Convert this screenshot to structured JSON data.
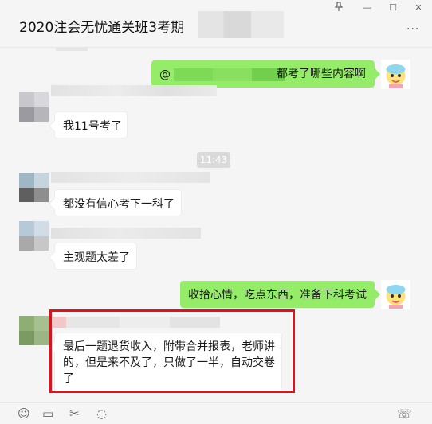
{
  "window": {
    "title": "2020注会无忧通关班3考期",
    "pin_icon": "pin-icon",
    "minimize_glyph": "—",
    "maximize_glyph": "☐",
    "close_glyph": "✕",
    "more_glyph": "···"
  },
  "colors": {
    "incoming_bubble": "#ffffff",
    "outgoing_bubble": "#95ec69",
    "highlight_border": "#e3101a",
    "timestamp_bg": "#dadada"
  },
  "messages": [
    {
      "direction": "out",
      "mention": "@",
      "text": "都考了哪些内容啊"
    },
    {
      "direction": "in",
      "text": "我11号考了"
    },
    {
      "direction": "in",
      "text": "都没有信心考下一科了"
    },
    {
      "direction": "in",
      "text": "主观题太差了"
    },
    {
      "direction": "out",
      "text": "收拾心情，吃点东西，准备下科考试"
    },
    {
      "direction": "in",
      "line1": "最后一题退货收入，附带合并报表，老师讲",
      "line2": "的，但是来不及了，只做了一半，自动交卷",
      "line3": "了"
    }
  ],
  "timestamp": "11:43",
  "toolbar": {
    "emoji_icon": "☺",
    "folder_icon": "▭",
    "scissors_icon": "✂",
    "chat_icon": "◌",
    "video_icon": "☏"
  }
}
